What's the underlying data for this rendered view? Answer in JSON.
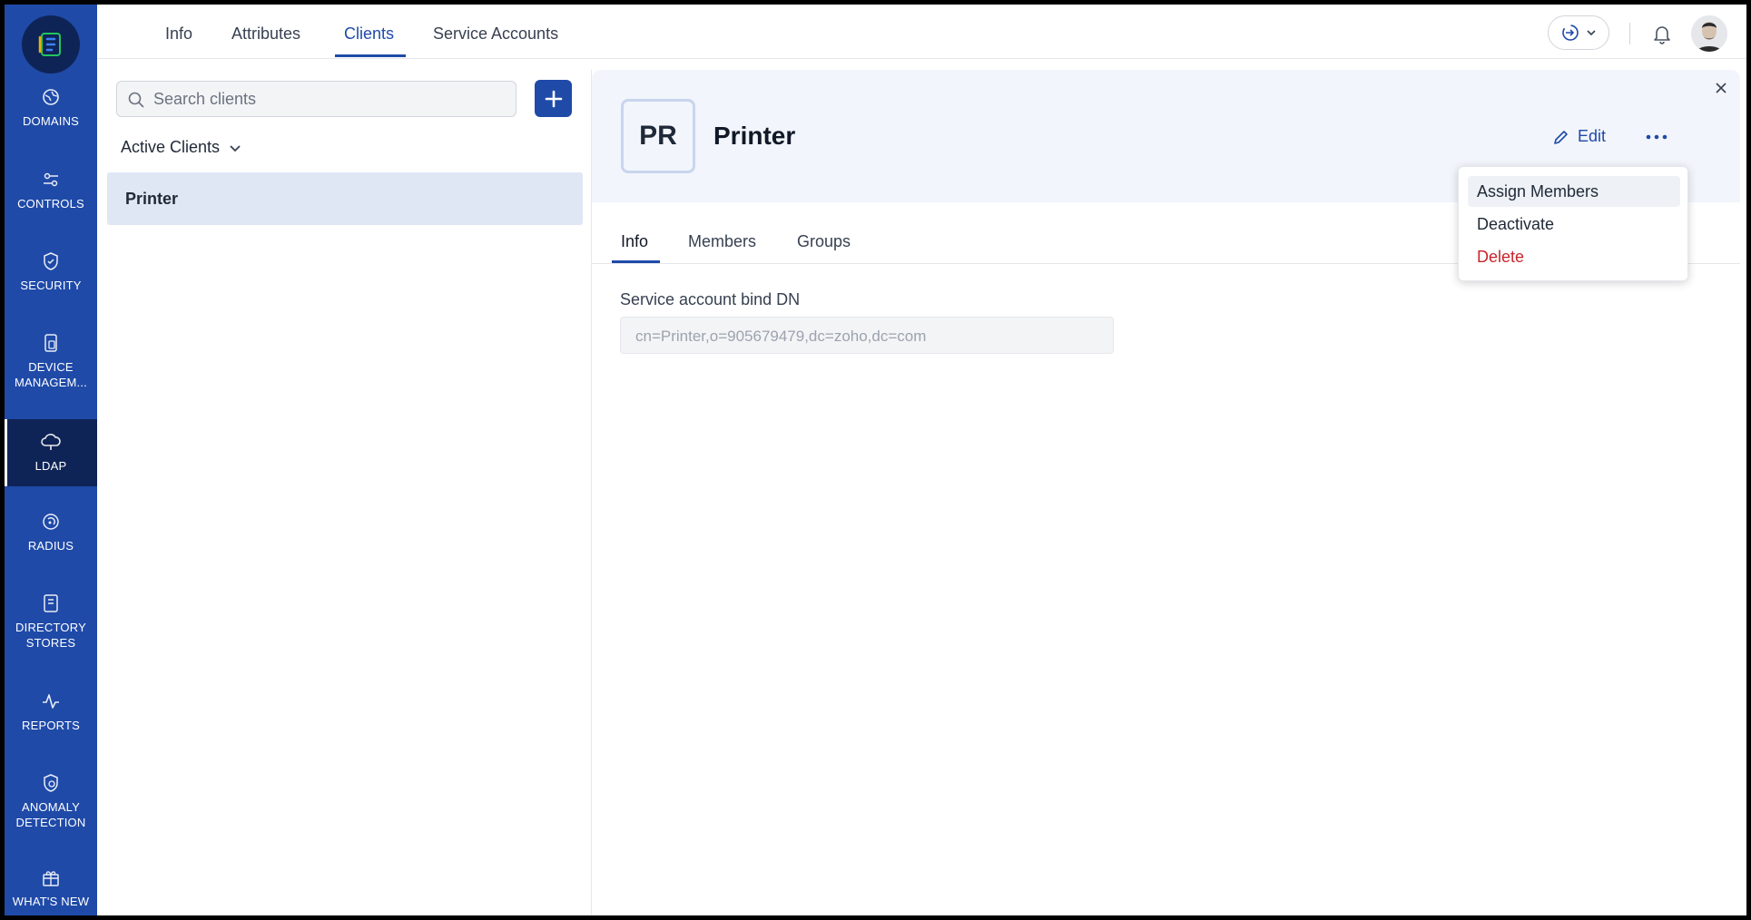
{
  "sidebar": {
    "items": [
      {
        "label": "DOMAINS",
        "icon": "domains-icon"
      },
      {
        "label": "CONTROLS",
        "icon": "controls-icon"
      },
      {
        "label": "SECURITY",
        "icon": "shield-icon"
      },
      {
        "label": "DEVICE MANAGEM...",
        "icon": "device-icon"
      },
      {
        "label": "LDAP",
        "icon": "cloud-icon",
        "active": true
      },
      {
        "label": "RADIUS",
        "icon": "radius-icon"
      },
      {
        "label": "DIRECTORY STORES",
        "icon": "book-icon"
      },
      {
        "label": "REPORTS",
        "icon": "pulse-icon"
      },
      {
        "label": "ANOMALY DETECTION",
        "icon": "anomaly-shield-icon"
      },
      {
        "label": "WHAT'S NEW",
        "icon": "gift-icon"
      }
    ]
  },
  "topnav": {
    "tabs": [
      {
        "label": "Info"
      },
      {
        "label": "Attributes"
      },
      {
        "label": "Clients",
        "active": true
      },
      {
        "label": "Service Accounts"
      }
    ]
  },
  "left": {
    "search_placeholder": "Search clients",
    "filter_label": "Active Clients",
    "clients": [
      {
        "name": "Printer"
      }
    ]
  },
  "detail": {
    "initials": "PR",
    "title": "Printer",
    "edit_label": "Edit",
    "tabs": [
      {
        "label": "Info",
        "active": true
      },
      {
        "label": "Members"
      },
      {
        "label": "Groups"
      }
    ],
    "field_label": "Service account bind DN",
    "field_value": "cn=Printer,o=905679479,dc=zoho,dc=com"
  },
  "menu": {
    "items": [
      {
        "label": "Assign Members"
      },
      {
        "label": "Deactivate"
      },
      {
        "label": "Delete"
      }
    ]
  },
  "colors": {
    "sidebar": "#1f4aa8",
    "sidebar_active": "#0f2456",
    "accent": "#1f4aa8",
    "danger": "#c8242b"
  }
}
